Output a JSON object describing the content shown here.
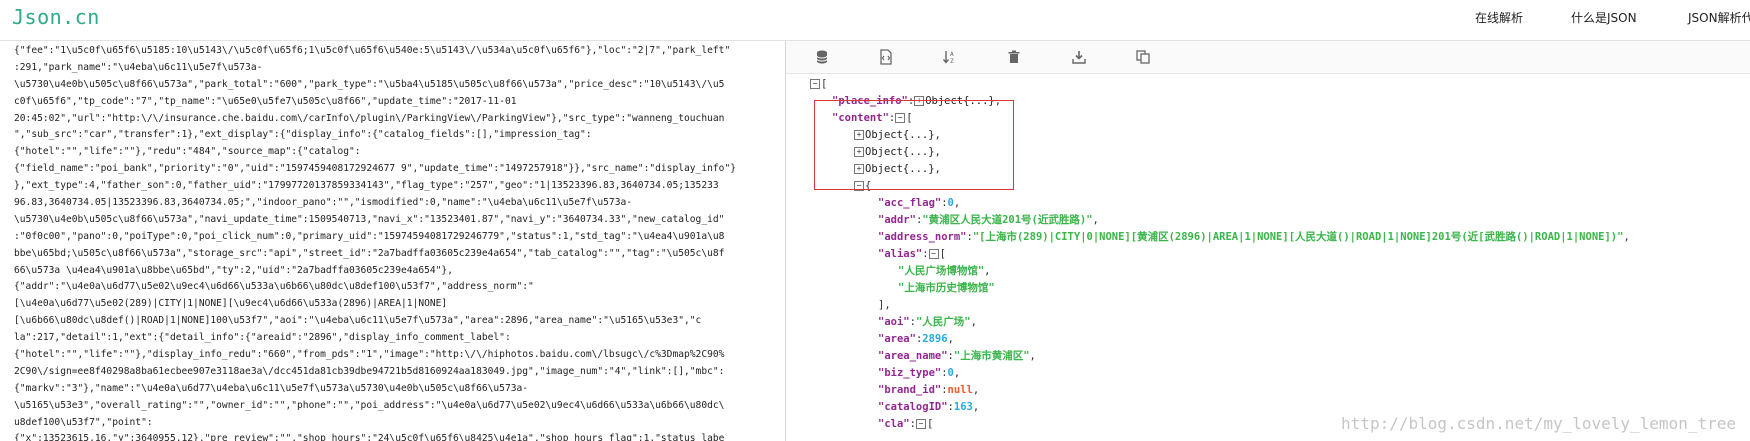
{
  "header": {
    "logo": "Json.cn",
    "nav": [
      "在线解析",
      "什么是JSON",
      "JSON解析代"
    ]
  },
  "raw_text": [
    "{\"fee\":\"1\\u5c0f\\u65f6\\u5185:10\\u5143\\/\\u5c0f\\u65f6;1\\u5c0f\\u65f6\\u540e:5\\u5143\\/\\u534a\\u5c0f\\u65f6\"},\"loc\":\"2|7\",\"park_left\"",
    ":291,\"park_name\":\"\\u4eba\\u6c11\\u5e7f\\u573a-",
    "\\u5730\\u4e0b\\u505c\\u8f66\\u573a\",\"park_total\":\"600\",\"park_type\":\"\\u5ba4\\u5185\\u505c\\u8f66\\u573a\",\"price_desc\":\"10\\u5143\\/\\u5",
    "c0f\\u65f6\",\"tp_code\":\"7\",\"tp_name\":\"\\u65e0\\u5fe7\\u505c\\u8f66\",\"update_time\":\"2017-11-01",
    "20:45:02\",\"url\":\"http:\\/\\/insurance.che.baidu.com\\/carInfo\\/plugin\\/ParkingView\\/ParkingView\"},\"src_type\":\"wanneng_touchuan",
    "\",\"sub_src\":\"car\",\"transfer\":1},\"ext_display\":{\"display_info\":{\"catalog_fields\":[],\"impression_tag\":",
    "{\"hotel\":\"\",\"life\":\"\"},\"redu\":\"484\",\"source_map\":{\"catalog\":",
    "{\"field_name\":\"poi_bank\",\"priority\":\"0\",\"uid\":\"1597459408172924677 9\",\"update_time\":\"1497257918\"}},\"src_name\":\"display_info\"}",
    "},\"ext_type\":4,\"father_son\":0,\"father_uid\":\"17997720137859334143\",\"flag_type\":\"257\",\"geo\":\"1|13523396.83,3640734.05;135233",
    "96.83,3640734.05|13523396.83,3640734.05;\",\"indoor_pano\":\"\",\"ismodified\":0,\"name\":\"\\u4eba\\u6c11\\u5e7f\\u573a-",
    "\\u5730\\u4e0b\\u505c\\u8f66\\u573a\",\"navi_update_time\":1509540713,\"navi_x\":\"13523401.87\",\"navi_y\":\"3640734.33\",\"new_catalog_id\"",
    ":\"0f0c00\",\"pano\":0,\"poiType\":0,\"poi_click_num\":0,\"primary_uid\":\"15974594081729246779\",\"status\":1,\"std_tag\":\"\\u4ea4\\u901a\\u8",
    "bbe\\u65bd;\\u505c\\u8f66\\u573a\",\"storage_src\":\"api\",\"street_id\":\"2a7badffa03605c239e4a654\",\"tab_catalog\":\"\",\"tag\":\"\\u505c\\u8f",
    "66\\u573a \\u4ea4\\u901a\\u8bbe\\u65bd\",\"ty\":2,\"uid\":\"2a7badffa03605c239e4a654\"},",
    "{\"addr\":\"\\u4e0a\\u6d77\\u5e02\\u9ec4\\u6d66\\u533a\\u6b66\\u80dc\\u8def100\\u53f7\",\"address_norm\":\"",
    "[\\u4e0a\\u6d77\\u5e02(289)|CITY|1|NONE][\\u9ec4\\u6d66\\u533a(2896)|AREA|1|NONE]",
    "[\\u6b66\\u80dc\\u8def()|ROAD|1|NONE]100\\u53f7\",\"aoi\":\"\\u4eba\\u6c11\\u5e7f\\u573a\",\"area\":2896,\"area_name\":\"\\u5165\\u53e3\",\"c",
    "la\":217,\"detail\":1,\"ext\":{\"detail_info\":{\"areaid\":\"2896\",\"display_info_comment_label\":",
    "{\"hotel\":\"\",\"life\":\"\"},\"display_info_redu\":\"660\",\"from_pds\":\"1\",\"image\":\"http:\\/\\/hiphotos.baidu.com\\/lbsugc\\/c%3Dmap%2C90%",
    "2C90\\/sign=ee8f40298a8ba61ecbee907e3118ae3a\\/dcc451da81cb39dbe94721b5d8160924aa183049.jpg\",\"image_num\":\"4\",\"link\":[],\"mbc\":",
    "{\"markv\":\"3\"},\"name\":\"\\u4e0a\\u6d77\\u4eba\\u6c11\\u5e7f\\u573a\\u5730\\u4e0b\\u505c\\u8f66\\u573a-",
    "\\u5165\\u53e3\",\"overall_rating\":\"\",\"owner_id\":\"\",\"phone\":\"\",\"poi_address\":\"\\u4e0a\\u6d77\\u5e02\\u9ec4\\u6d66\\u533a\\u6b66\\u80dc\\",
    "u8def100\\u53f7\",\"point\":",
    "{\"x\":13523615.16,\"y\":3640955.12},\"pre_review\":\"\",\"shop_hours\":\"24\\u5c0f\\u65f6\\u8425\\u4e1a\",\"shop_hours_flag\":1,\"status_labe"
  ],
  "tree": {
    "root_open": "[",
    "place_info_key": "\"place_info\"",
    "object_collapsed": "Object{...}",
    "content_key": "\"content\"",
    "array_open": "[",
    "items": [
      {
        "key": "\"acc_flag\"",
        "value": "0",
        "type": "num"
      },
      {
        "key": "\"addr\"",
        "value": "\"黄浦区人民大道201号(近武胜路)\"",
        "type": "str"
      },
      {
        "key": "\"address_norm\"",
        "value": "\"[上海市(289)|CITY|0|NONE][黄浦区(2896)|AREA|1|NONE][人民大道()|ROAD|1|NONE]201号(近[武胜路()|ROAD|1|NONE])\"",
        "type": "str"
      },
      {
        "key": "\"alias\"",
        "value": "[",
        "type": "arr"
      },
      {
        "key": "\"aoi\"",
        "value": "\"人民广场\"",
        "type": "str"
      },
      {
        "key": "\"area\"",
        "value": "2896",
        "type": "num"
      },
      {
        "key": "\"area_name\"",
        "value": "\"上海市黄浦区\"",
        "type": "str"
      },
      {
        "key": "\"biz_type\"",
        "value": "0",
        "type": "num"
      },
      {
        "key": "\"brand_id\"",
        "value": "null",
        "type": "nul"
      },
      {
        "key": "\"catalogID\"",
        "value": "163",
        "type": "num"
      },
      {
        "key": "\"cla\"",
        "value": "[",
        "type": "arr"
      }
    ],
    "alias_values": [
      "\"人民广场博物馆\"",
      "\"上海市历史博物馆\""
    ],
    "alias_close": "],"
  },
  "watermark": "http://blog.csdn.net/my_lovely_lemon_tree",
  "colors": {
    "logo": "#2eaa8e",
    "key": "#92278f",
    "string": "#3ab54a",
    "number": "#25aae2",
    "null": "#f1592a",
    "highlight": "#d9363e"
  },
  "toolbar_icons": [
    "database-icon",
    "format-file-icon",
    "sort-icon",
    "delete-icon",
    "download-icon",
    "copy-icon"
  ]
}
